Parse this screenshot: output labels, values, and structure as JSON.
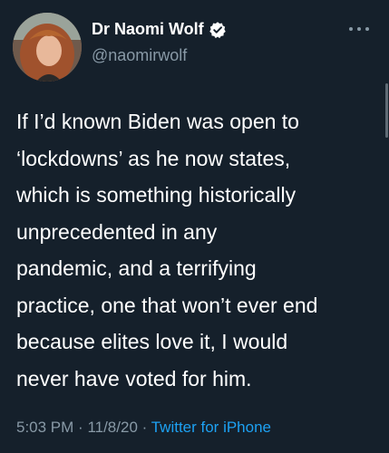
{
  "tweet": {
    "author": {
      "display_name": "Dr Naomi Wolf",
      "handle": "@naomirwolf",
      "verified": true,
      "avatar_icon": "profile-photo"
    },
    "more_icon": "ellipsis-icon",
    "text_lines": [
      "If I’d known Biden was open to",
      "‘lockdowns’ as he now states,",
      "which is something historically",
      "unprecedented in any",
      "pandemic, and a terrifying",
      "practice, one that won’t ever end",
      "because elites love it, I would",
      "never have voted for him."
    ],
    "time": "5:03 PM",
    "separator": "·",
    "date": "11/8/20",
    "source": "Twitter for iPhone"
  },
  "colors": {
    "background": "#15202b",
    "text": "#ffffff",
    "secondary": "#8899a6",
    "accent": "#1da1f2"
  }
}
